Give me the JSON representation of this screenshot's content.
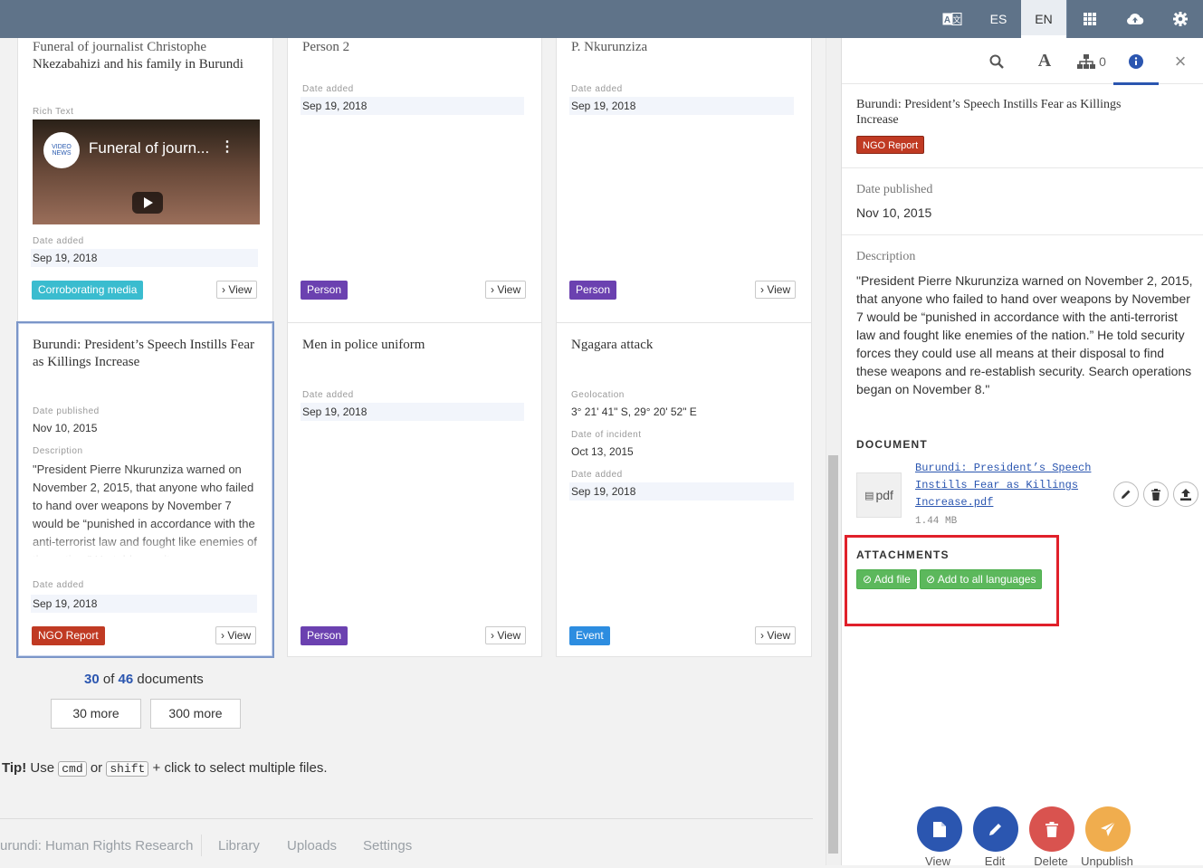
{
  "topbar": {
    "lang_es": "ES",
    "lang_en": "EN"
  },
  "cards": {
    "c1": {
      "title_partial": "Funeral of journalist Christophe",
      "title": "Nkezabahizi and his family in Burundi",
      "rich_text_label": "Rich Text",
      "video_title": "Funeral of journ...",
      "video_logo": "VIDEO NEWS",
      "date_label": "Date added",
      "date": "Sep 19, 2018",
      "badge": "Corroborating media",
      "view": "View"
    },
    "c2": {
      "title_partial": "Person 2",
      "date_label": "Date added",
      "date": "Sep 19, 2018",
      "badge": "Person",
      "view": "View"
    },
    "c3": {
      "title_partial": "P. Nkurunziza",
      "date_label": "Date added",
      "date": "Sep 19, 2018",
      "badge": "Person",
      "view": "View"
    },
    "c4": {
      "title": "Burundi: President’s Speech Instills Fear as Killings Increase",
      "published_label": "Date published",
      "published": "Nov 10, 2015",
      "desc_label": "Description",
      "desc": "\"President Pierre Nkurunziza warned on November 2, 2015, that anyone who failed to hand over weapons by November 7 would be “punished in accordance with the anti-terrorist law and fought like enemies of the nation.” He told security",
      "date_label": "Date added",
      "date": "Sep 19, 2018",
      "badge": "NGO Report",
      "view": "View"
    },
    "c5": {
      "title": "Men in police uniform",
      "date_label": "Date added",
      "date": "Sep 19, 2018",
      "badge": "Person",
      "view": "View"
    },
    "c6": {
      "title": "Ngagara attack",
      "geo_label": "Geolocation",
      "geo": "3° 21' 41\" S, 29° 20' 52\" E",
      "incident_label": "Date of incident",
      "incident": "Oct 13, 2015",
      "date_label": "Date added",
      "date": "Sep 19, 2018",
      "badge": "Event",
      "view": "View"
    }
  },
  "pagination": {
    "shown": "30",
    "of": "of",
    "total": "46",
    "suffix": "documents",
    "more30": "30 more",
    "more300": "300 more"
  },
  "tip": {
    "bold": "Tip!",
    "use": "Use",
    "key1": "cmd",
    "or": "or",
    "key2": "shift",
    "rest": "+ click to select multiple files."
  },
  "footer": {
    "site": "urundi: Human Rights Research",
    "library": "Library",
    "uploads": "Uploads",
    "settings": "Settings"
  },
  "panel": {
    "connections_count": "0",
    "title": "Burundi: President’s Speech Instills Fear as Killings Increase",
    "badge": "NGO Report",
    "date_label": "Date published",
    "date": "Nov 10, 2015",
    "desc_label": "Description",
    "desc": "\"President Pierre Nkurunziza warned on November 2, 2015, that anyone who failed to hand over weapons by November 7 would be “punished in accordance with the anti-terrorist law and fought like enemies of the nation.” He told security forces they could use all means at their disposal to find these weapons and re-establish security. Search operations began on November 8.\"",
    "document_heading": "DOCUMENT",
    "pdf_thumb": "pdf",
    "file_name": "Burundi: President’s Speech Instills Fear as Killings Increase.pdf",
    "file_size": "1.44 MB",
    "attachments_heading": "ATTACHMENTS",
    "add_file": "Add file",
    "add_all": "Add to all languages",
    "actions": {
      "view": "View",
      "edit": "Edit",
      "delete": "Delete",
      "unpublish": "Unpublish"
    }
  },
  "colors": {
    "topbar": "#5f7389",
    "accent": "#2b56b0",
    "teal": "#3abccf",
    "purple": "#6b41b0",
    "red": "#c03a23",
    "event_blue": "#2d8de0",
    "green": "#5cb85c",
    "fab_blue": "#2b56b0",
    "fab_delete": "#d9534f",
    "fab_unpublish": "#f0ad4e",
    "highlight": "#e0202a"
  }
}
